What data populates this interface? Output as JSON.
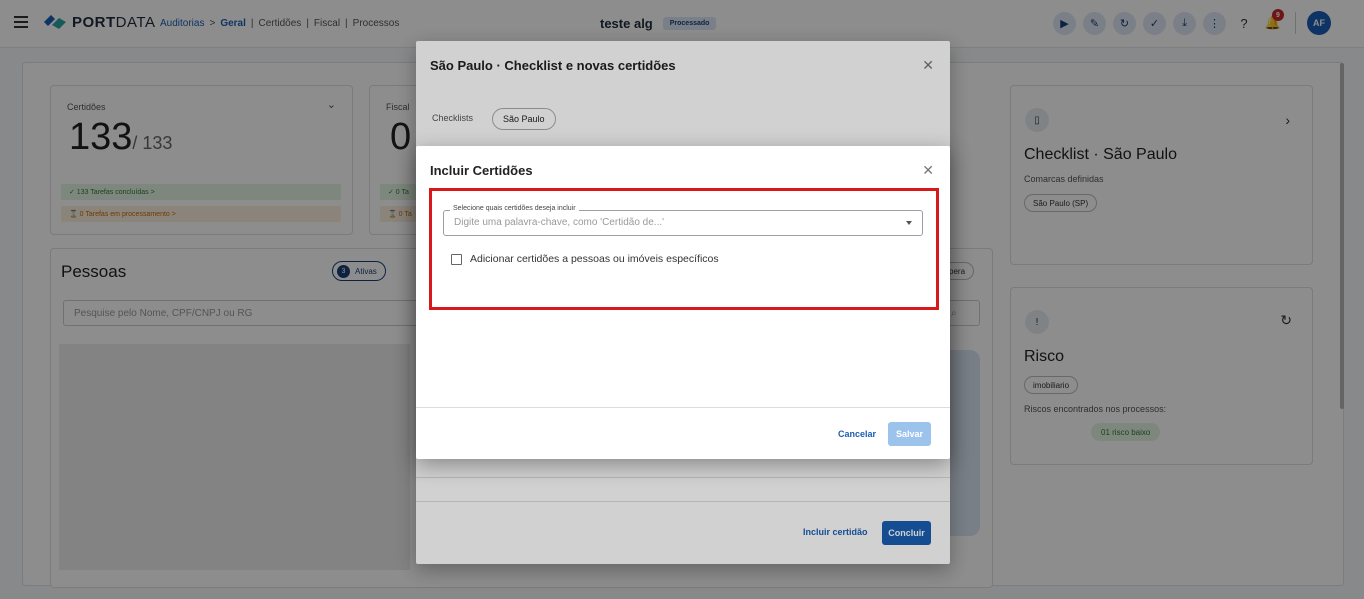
{
  "topbar": {
    "logo_bold": "PORT",
    "logo_thin": "DATA",
    "breadcrumb": {
      "auditorias": "Auditorias",
      "arrow": ">",
      "geral": "Geral",
      "certidoes": "Certidões",
      "fiscal": "Fiscal",
      "processos": "Processos",
      "sep": "|"
    },
    "page_title": "teste alg",
    "status": "Processado",
    "notification_count": "9",
    "avatar_initials": "AF"
  },
  "background": {
    "certidoes_card": {
      "label": "Certidões",
      "count": "133",
      "total": "/ 133",
      "done": "✓ 133 Tarefas concluídas >",
      "processing": "⌛ 0 Tarefas em processamento >"
    },
    "fiscal_card": {
      "label": "Fiscal",
      "count": "0",
      "done": "✓ 0 Ta",
      "processing": "⌛ 0 Ta"
    },
    "pessoas": {
      "title": "Pessoas",
      "ativas_count": "3",
      "ativas_label": "Ativas",
      "search_placeholder": "Pesquise pelo Nome, CPF/CNPJ ou RG",
      "right_chip": "pera"
    },
    "checklist_card": {
      "title": "Checklist · São Paulo",
      "subtitle": "Comarcas definidas",
      "chip": "São Paulo (SP)"
    },
    "risco_card": {
      "title": "Risco",
      "chip": "imobiliario",
      "subtitle": "Riscos encontrados nos processos:",
      "result": "01 risco baixo"
    }
  },
  "dialog_back": {
    "title": "São Paulo · Checklist e novas certidões",
    "checklists_label": "Checklists",
    "checklist_chip": "São Paulo",
    "incluir_label": "Incluir certidão",
    "concluir_label": "Concluir"
  },
  "dialog_front": {
    "title": "Incluir Certidões",
    "select_legend": "Selecione quais certidões deseja incluir",
    "select_placeholder": "Digite uma palavra-chave, como 'Certidão de...'",
    "checkbox_label": "Adicionar certidões a pessoas ou imóveis específicos",
    "cancel_label": "Cancelar",
    "save_label": "Salvar"
  },
  "colors": {
    "primary": "#1a5fb4",
    "highlight": "#d7191c",
    "save_disabled": "#9cc3ec"
  }
}
